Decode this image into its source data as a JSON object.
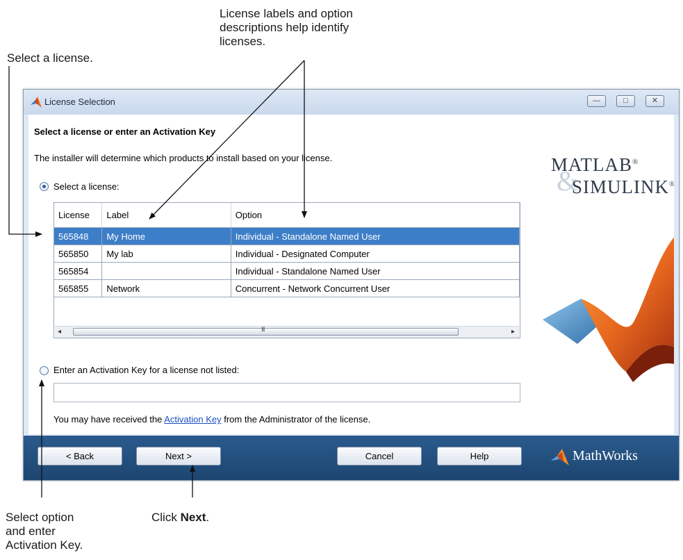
{
  "annotations": {
    "select_license": "Select a license.",
    "labels_descriptions": [
      "License labels and option",
      "descriptions help identify",
      "licenses."
    ],
    "select_option": [
      "Select option",
      "and enter",
      "Activation Key."
    ],
    "click_prefix": "Click ",
    "click_bold": "Next",
    "click_suffix": "."
  },
  "window": {
    "title": "License Selection",
    "controls": {
      "minimize": "—",
      "maximize": "□",
      "close": "✕"
    }
  },
  "content": {
    "heading": "Select a license or enter an Activation Key",
    "subtext": "The installer will determine which products to install based on your license.",
    "radio_select_label": "Select a license:",
    "radio_key_label": "Enter an Activation Key for a license not listed:",
    "key_input_value": "",
    "help_prefix": "You may have received the ",
    "help_link": "Activation Key",
    "help_suffix": " from the Administrator of the license."
  },
  "table": {
    "columns": [
      "License",
      "Label",
      "Option"
    ],
    "rows": [
      {
        "license": "565848",
        "label": "My Home",
        "option": "Individual - Standalone Named User",
        "selected": true
      },
      {
        "license": "565850",
        "label": "My lab",
        "option": "Individual - Designated Computer",
        "selected": false
      },
      {
        "license": "565854",
        "label": "",
        "option": "Individual - Standalone Named User",
        "selected": false
      },
      {
        "license": "565855",
        "label": "Network",
        "option": "Concurrent - Network Concurrent User",
        "selected": false
      }
    ],
    "scroll_left": "◂",
    "scroll_right": "▸",
    "scroll_grip": "III"
  },
  "branding": {
    "matlab": "MATLAB",
    "simulink": "SIMULINK",
    "registered": "®",
    "ampersand": "&",
    "mathworks": "MathWorks"
  },
  "footer": {
    "back": "< Back",
    "next": "Next >",
    "cancel": "Cancel",
    "help": "Help"
  },
  "colors": {
    "selection": "#3d7ec8",
    "footer": "#1d4571",
    "link": "#1b4fc4",
    "accent_orange": "#e8681f"
  }
}
